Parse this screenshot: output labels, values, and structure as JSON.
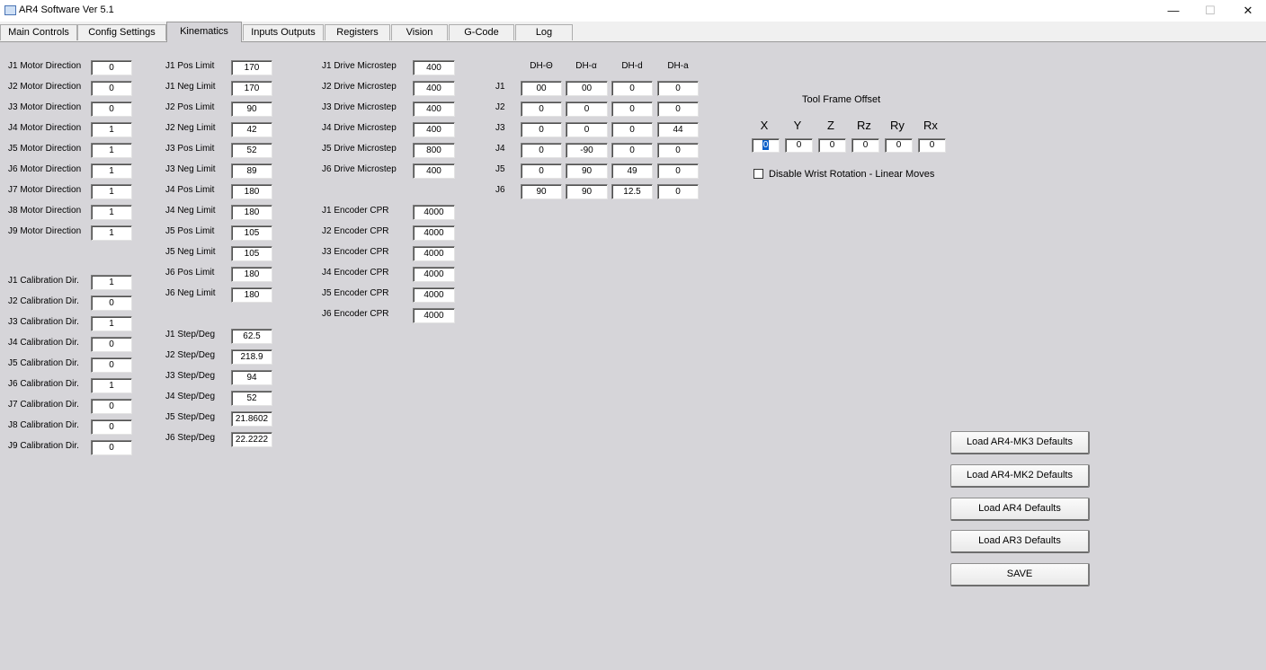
{
  "window": {
    "title": "AR4 Software Ver 5.1",
    "minimize": "—",
    "restore": "☐",
    "close": "✕"
  },
  "tabs": [
    "Main Controls",
    "Config Settings",
    "Kinematics",
    "Inputs Outputs",
    "Registers",
    "Vision",
    "G-Code",
    "Log"
  ],
  "active_tab": "Kinematics",
  "motor_direction": {
    "labels": [
      "J1 Motor Direction",
      "J2 Motor Direction",
      "J3 Motor Direction",
      "J4 Motor Direction",
      "J5 Motor Direction",
      "J6 Motor Direction",
      "J7 Motor Direction",
      "J8 Motor Direction",
      "J9 Motor Direction"
    ],
    "values": [
      "0",
      "0",
      "0",
      "1",
      "1",
      "1",
      "1",
      "1",
      "1"
    ]
  },
  "calibration_dir": {
    "labels": [
      "J1 Calibration Dir.",
      "J2 Calibration Dir.",
      "J3 Calibration Dir.",
      "J4 Calibration Dir.",
      "J5 Calibration Dir.",
      "J6 Calibration Dir.",
      "J7 Calibration Dir.",
      "J8 Calibration Dir.",
      "J9 Calibration Dir."
    ],
    "values": [
      "1",
      "0",
      "1",
      "0",
      "0",
      "1",
      "0",
      "0",
      "0"
    ]
  },
  "limits": {
    "labels": [
      "J1 Pos Limit",
      "J1 Neg Limit",
      "J2 Pos Limit",
      "J2 Neg Limit",
      "J3 Pos Limit",
      "J3 Neg Limit",
      "J4 Pos Limit",
      "J4 Neg Limit",
      "J5 Pos Limit",
      "J5 Neg Limit",
      "J6 Pos Limit",
      "J6 Neg Limit"
    ],
    "values": [
      "170",
      "170",
      "90",
      "42",
      "52",
      "89",
      "180",
      "180",
      "105",
      "105",
      "180",
      "180"
    ]
  },
  "step_deg": {
    "labels": [
      "J1 Step/Deg",
      "J2 Step/Deg",
      "J3 Step/Deg",
      "J4 Step/Deg",
      "J5 Step/Deg",
      "J6 Step/Deg"
    ],
    "values": [
      "62.5",
      "218.9",
      "94",
      "52",
      "21.8602",
      "22.2222"
    ]
  },
  "drive_microstep": {
    "labels": [
      "J1 Drive Microstep",
      "J2 Drive Microstep",
      "J3 Drive Microstep",
      "J4 Drive Microstep",
      "J5 Drive Microstep",
      "J6 Drive Microstep"
    ],
    "values": [
      "400",
      "400",
      "400",
      "400",
      "800",
      "400"
    ]
  },
  "encoder_cpr": {
    "labels": [
      "J1 Encoder CPR",
      "J2 Encoder CPR",
      "J3 Encoder CPR",
      "J4 Encoder CPR",
      "J5 Encoder CPR",
      "J6 Encoder CPR"
    ],
    "values": [
      "4000",
      "4000",
      "4000",
      "4000",
      "4000",
      "4000"
    ]
  },
  "dh": {
    "headers": [
      "DH-Θ",
      "DH-α",
      "DH-d",
      "DH-a"
    ],
    "rows": [
      {
        "label": "J1",
        "values": [
          "00",
          "00",
          "0",
          "0"
        ]
      },
      {
        "label": "J2",
        "values": [
          "0",
          "0",
          "0",
          "0"
        ]
      },
      {
        "label": "J3",
        "values": [
          "0",
          "0",
          "0",
          "44"
        ]
      },
      {
        "label": "J4",
        "values": [
          "0",
          "-90",
          "0",
          "0"
        ]
      },
      {
        "label": "J5",
        "values": [
          "0",
          "90",
          "49",
          "0"
        ]
      },
      {
        "label": "J6",
        "values": [
          "90",
          "90",
          "12.5",
          "0"
        ]
      }
    ]
  },
  "tool_frame": {
    "title": "Tool Frame Offset",
    "headers": [
      "X",
      "Y",
      "Z",
      "Rz",
      "Ry",
      "Rx"
    ],
    "values": [
      "0",
      "0",
      "0",
      "0",
      "0",
      "0"
    ]
  },
  "disable_wrist": {
    "label": "Disable Wrist Rotation - Linear Moves",
    "checked": false
  },
  "buttons": [
    "Load AR4-MK3 Defaults",
    "Load AR4-MK2 Defaults",
    "Load AR4 Defaults",
    "Load AR3 Defaults",
    "SAVE"
  ]
}
